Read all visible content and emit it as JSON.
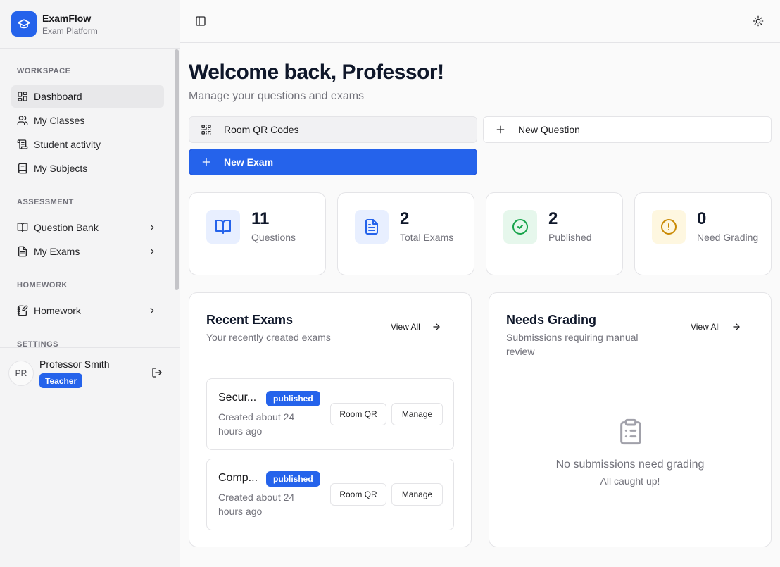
{
  "app": {
    "name": "ExamFlow",
    "subtitle": "Exam Platform",
    "logo_icon": "graduation-cap-icon"
  },
  "sidebar": {
    "sections": [
      {
        "label": "WORKSPACE",
        "items": [
          {
            "label": "Dashboard",
            "icon": "layout-grid-icon",
            "active": true
          },
          {
            "label": "My Classes",
            "icon": "users-icon"
          },
          {
            "label": "Student activity",
            "icon": "scroll-icon"
          },
          {
            "label": "My Subjects",
            "icon": "book-icon"
          }
        ]
      },
      {
        "label": "ASSESSMENT",
        "items": [
          {
            "label": "Question Bank",
            "icon": "book-open-icon",
            "has_submenu": true
          },
          {
            "label": "My Exams",
            "icon": "file-text-icon",
            "has_submenu": true
          }
        ]
      },
      {
        "label": "HOMEWORK",
        "items": [
          {
            "label": "Homework",
            "icon": "notebook-pen-icon",
            "has_submenu": true
          }
        ]
      },
      {
        "label": "SETTINGS",
        "items": []
      }
    ],
    "user": {
      "initials": "PR",
      "name": "Professor Smith",
      "role": "Teacher"
    }
  },
  "header": {
    "title": "Welcome back, Professor!",
    "subtitle": "Manage your questions and exams"
  },
  "actions": {
    "room_qr": "Room QR Codes",
    "new_question": "New Question",
    "new_exam": "New Exam"
  },
  "stats": [
    {
      "value": "11",
      "label": "Questions",
      "icon": "book-open-icon",
      "color": "#2563eb",
      "bg": "#e8efff"
    },
    {
      "value": "2",
      "label": "Total Exams",
      "icon": "file-text-icon",
      "color": "#2563eb",
      "bg": "#e8efff"
    },
    {
      "value": "2",
      "label": "Published",
      "icon": "check-circle-icon",
      "color": "#16a34a",
      "bg": "#e6f7ec"
    },
    {
      "value": "0",
      "label": "Need Grading",
      "icon": "alert-circle-icon",
      "color": "#ca8a04",
      "bg": "#fef7e0"
    }
  ],
  "recent_exams": {
    "title": "Recent Exams",
    "subtitle": "Your recently created exams",
    "view_all": "View All",
    "items": [
      {
        "title": "Secur...",
        "status": "published",
        "meta": "Created about 24 hours ago",
        "room_qr": "Room QR",
        "manage": "Manage"
      },
      {
        "title": "Comp...",
        "status": "published",
        "meta": "Created about 24 hours ago",
        "room_qr": "Room QR",
        "manage": "Manage"
      }
    ]
  },
  "needs_grading": {
    "title": "Needs Grading",
    "subtitle": "Submissions requiring manual review",
    "view_all": "View All",
    "empty_title": "No submissions need grading",
    "empty_sub": "All caught up!"
  },
  "colors": {
    "primary": "#2563eb",
    "success": "#16a34a",
    "warning": "#ca8a04"
  }
}
